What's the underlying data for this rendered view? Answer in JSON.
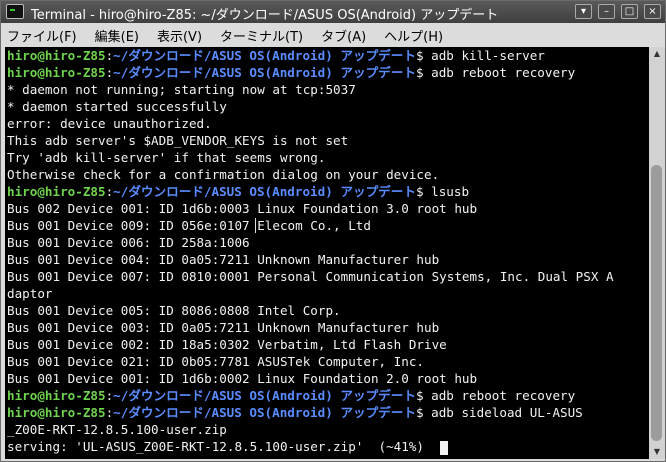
{
  "window": {
    "title": "Terminal - hiro@hiro-Z85: ~/ダウンロード/ASUS OS(Android) アップデート",
    "buttons": {
      "minimize": "–",
      "maximize": "□",
      "close": "×",
      "menu": "▾"
    }
  },
  "menu": [
    "ファイル(F)",
    "編集(E)",
    "表示(V)",
    "ターミナル(T)",
    "タブ(A)",
    "ヘルプ(H)"
  ],
  "prompt": {
    "user": "hiro@hiro-Z85",
    "path": "~/ダウンロード/ASUS OS(Android) アップデート",
    "symbol": "$"
  },
  "lines": [
    {
      "kind": "cmd",
      "text": "adb kill-server"
    },
    {
      "kind": "cmd",
      "text": "adb reboot recovery"
    },
    {
      "kind": "out",
      "text": "* daemon not running; starting now at tcp:5037"
    },
    {
      "kind": "out",
      "text": "* daemon started successfully"
    },
    {
      "kind": "out",
      "text": "error: device unauthorized."
    },
    {
      "kind": "out",
      "text": "This adb server's $ADB_VENDOR_KEYS is not set"
    },
    {
      "kind": "out",
      "text": "Try 'adb kill-server' if that seems wrong."
    },
    {
      "kind": "out",
      "text": "Otherwise check for a confirmation dialog on your device."
    },
    {
      "kind": "cmd",
      "text": "lsusb"
    },
    {
      "kind": "out",
      "text": "Bus 002 Device 001: ID 1d6b:0003 Linux Foundation 3.0 root hub"
    },
    {
      "kind": "ibeam",
      "before": "Bus 001 Device 009: ID 056e:0107 ",
      "after": "Elecom Co., Ltd"
    },
    {
      "kind": "out",
      "text": "Bus 001 Device 006: ID 258a:1006"
    },
    {
      "kind": "out",
      "text": "Bus 001 Device 004: ID 0a05:7211 Unknown Manufacturer hub"
    },
    {
      "kind": "out",
      "text": "Bus 001 Device 007: ID 0810:0001 Personal Communication Systems, Inc. Dual PSX A"
    },
    {
      "kind": "out",
      "text": "daptor"
    },
    {
      "kind": "out",
      "text": "Bus 001 Device 005: ID 8086:0808 Intel Corp."
    },
    {
      "kind": "out",
      "text": "Bus 001 Device 003: ID 0a05:7211 Unknown Manufacturer hub"
    },
    {
      "kind": "out",
      "text": "Bus 001 Device 002: ID 18a5:0302 Verbatim, Ltd Flash Drive"
    },
    {
      "kind": "out",
      "text": "Bus 001 Device 021: ID 0b05:7781 ASUSTek Computer, Inc."
    },
    {
      "kind": "out",
      "text": "Bus 001 Device 001: ID 1d6b:0002 Linux Foundation 2.0 root hub"
    },
    {
      "kind": "cmd",
      "text": "adb reboot recovery"
    },
    {
      "kind": "cmd",
      "text": "adb sideload UL-ASUS"
    },
    {
      "kind": "out",
      "text": "_Z00E-RKT-12.8.5.100-user.zip"
    },
    {
      "kind": "cursor",
      "text": "serving: 'UL-ASUS_Z00E-RKT-12.8.5.100-user.zip'  (~41%)  "
    }
  ],
  "colors": {
    "user": "#6ed34d",
    "path": "#5a8cff",
    "text": "#f2f2f2",
    "background": "#000000"
  }
}
